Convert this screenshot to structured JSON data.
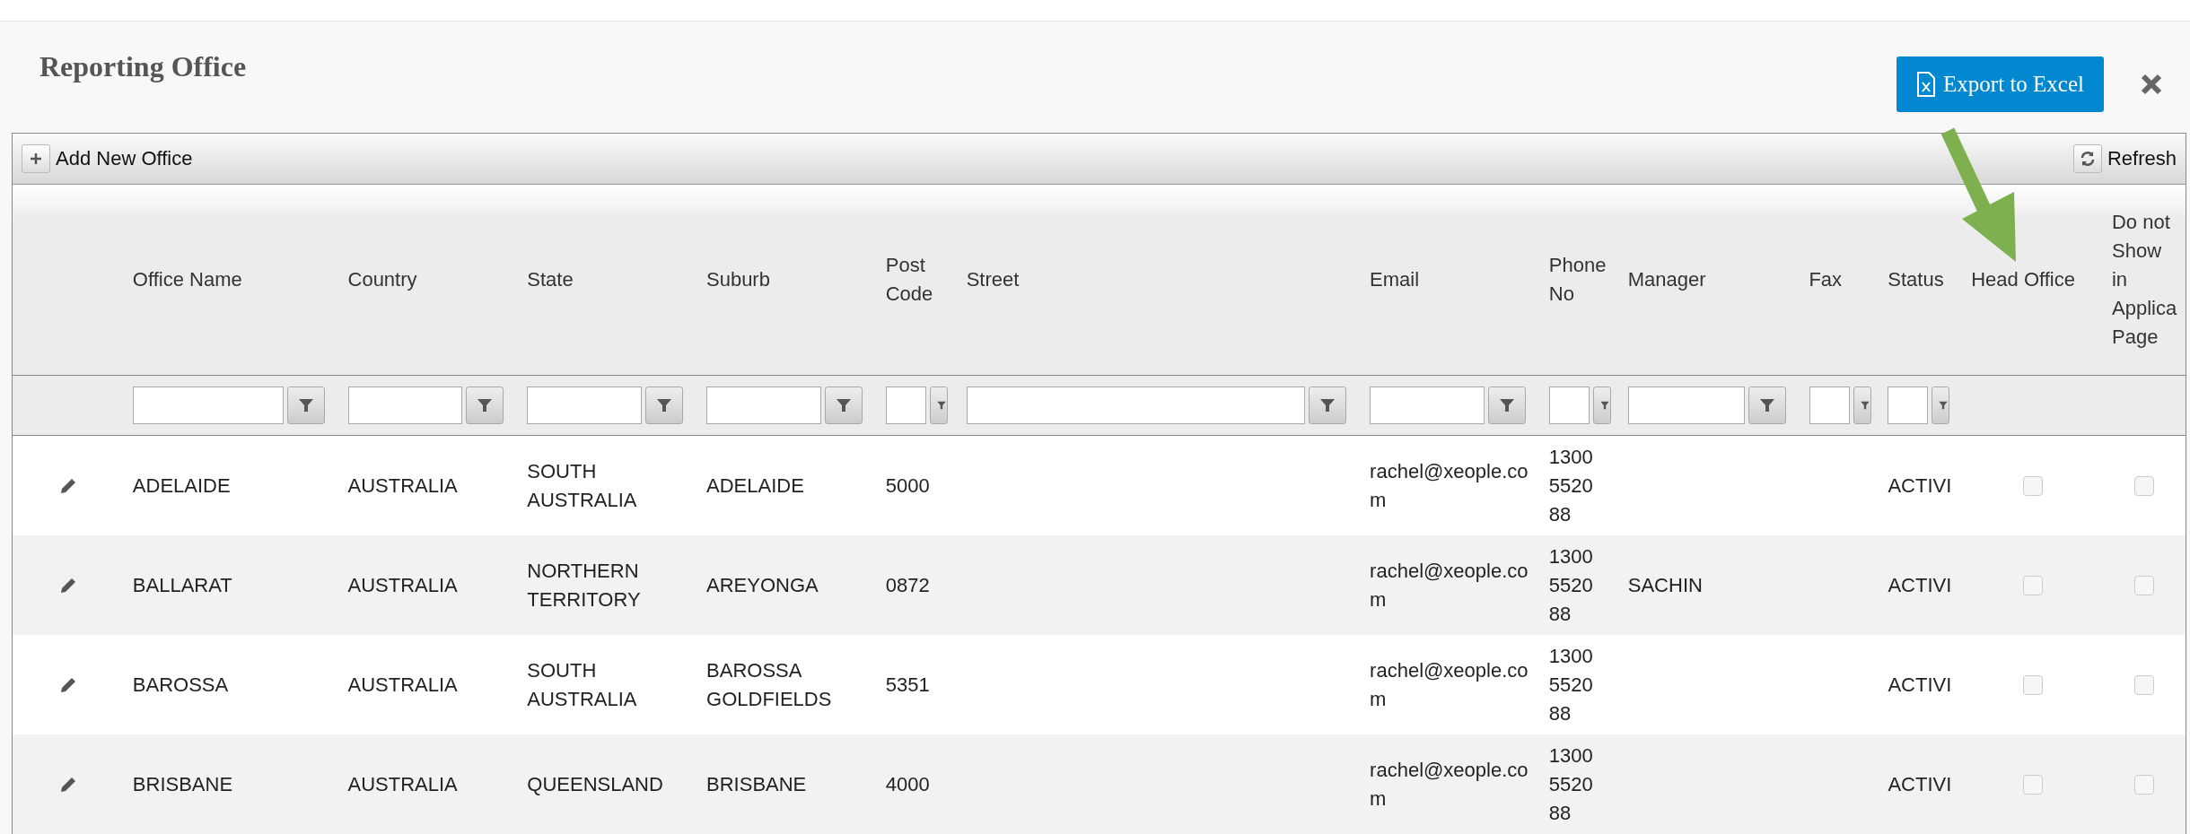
{
  "dialog": {
    "title": "Reporting Office",
    "export_button": "Export to Excel"
  },
  "toolbar": {
    "add_button": "Add New Office",
    "refresh_button": "Refresh"
  },
  "table": {
    "columns": [
      {
        "label": "Office Name",
        "kind": "text"
      },
      {
        "label": "Country",
        "kind": "text"
      },
      {
        "label": "State",
        "kind": "text"
      },
      {
        "label": "Suburb",
        "kind": "text"
      },
      {
        "label": "Post Code",
        "kind": "text"
      },
      {
        "label": "Street",
        "kind": "text"
      },
      {
        "label": "Email",
        "kind": "text"
      },
      {
        "label": "Phone No",
        "kind": "text"
      },
      {
        "label": "Manager",
        "kind": "text"
      },
      {
        "label": "Fax",
        "kind": "text"
      },
      {
        "label": "Status",
        "kind": "text"
      },
      {
        "label": "Head Office",
        "kind": "checkbox"
      },
      {
        "label": "Do not Show in Applica Page",
        "kind": "checkbox"
      }
    ],
    "rows": [
      {
        "cells": [
          "ADELAIDE",
          "AUSTRALIA",
          "SOUTH AUSTRALIA",
          "ADELAIDE",
          "5000",
          "",
          "rachel@xeople.com",
          "1300 5520 88",
          "",
          "",
          "ACTIVI"
        ],
        "head_office": false,
        "hide_in_application_page": false
      },
      {
        "cells": [
          "BALLARAT",
          "AUSTRALIA",
          "NORTHERN TERRITORY",
          "AREYONGA",
          "0872",
          "",
          "rachel@xeople.com",
          "1300 5520 88",
          "SACHIN",
          "",
          "ACTIVI"
        ],
        "head_office": false,
        "hide_in_application_page": false
      },
      {
        "cells": [
          "BAROSSA",
          "AUSTRALIA",
          "SOUTH AUSTRALIA",
          "BAROSSA GOLDFIELDS",
          "5351",
          "",
          "rachel@xeople.com",
          "1300 5520 88",
          "",
          "",
          "ACTIVI"
        ],
        "head_office": false,
        "hide_in_application_page": false
      },
      {
        "cells": [
          "BRISBANE",
          "AUSTRALIA",
          "QUEENSLAND",
          "BRISBANE",
          "4000",
          "",
          "rachel@xeople.com",
          "1300 5520 88",
          "",
          "",
          "ACTIVI"
        ],
        "head_office": false,
        "hide_in_application_page": false
      }
    ]
  }
}
